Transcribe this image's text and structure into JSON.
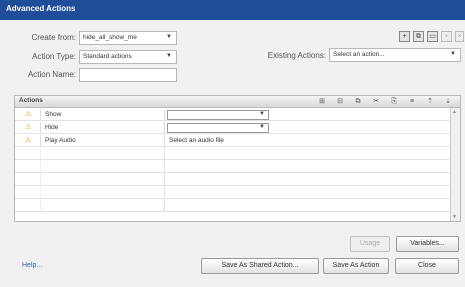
{
  "window": {
    "title": "Advanced Actions"
  },
  "form": {
    "create_from_label": "Create from:",
    "create_from_value": "hide_all_show_me",
    "action_type_label": "Action Type:",
    "action_type_value": "Standard actions",
    "action_name_label": "Action Name:",
    "action_name_value": "",
    "existing_actions_label": "Existing Actions:",
    "existing_actions_value": "Select an action..."
  },
  "top_toolbar": {
    "icons": [
      "add-action-icon",
      "duplicate-action-icon",
      "open-folder-icon",
      "save-icon",
      "delete-icon"
    ]
  },
  "actions_panel": {
    "title": "Actions",
    "toolbar_icons": [
      "add-row-icon",
      "delete-row-icon",
      "copy-row-icon",
      "cut-row-icon",
      "paste-row-icon",
      "insert-row-icon",
      "move-up-icon",
      "move-down-icon"
    ],
    "rows": [
      {
        "warning": true,
        "action": "Show",
        "value": "",
        "has_dropdown": true
      },
      {
        "warning": true,
        "action": "Hide",
        "value": "",
        "has_dropdown": true
      },
      {
        "warning": true,
        "action": "Play Audio",
        "value": "Select an audio file",
        "has_dropdown": false
      },
      {
        "warning": false,
        "action": "",
        "value": "",
        "has_dropdown": false
      },
      {
        "warning": false,
        "action": "",
        "value": "",
        "has_dropdown": false
      },
      {
        "warning": false,
        "action": "",
        "value": "",
        "has_dropdown": false
      },
      {
        "warning": false,
        "action": "",
        "value": "",
        "has_dropdown": false
      },
      {
        "warning": false,
        "action": "",
        "value": "",
        "has_dropdown": false
      }
    ]
  },
  "buttons": {
    "usage": "Usage",
    "variables": "Variables...",
    "save_as_shared": "Save As Shared Action...",
    "save_as_action": "Save As Action",
    "close": "Close"
  },
  "help": {
    "label": "Help..."
  },
  "colors": {
    "titlebar": "#1f4d9a",
    "warning": "#e59a00",
    "link": "#2b5fb5"
  }
}
